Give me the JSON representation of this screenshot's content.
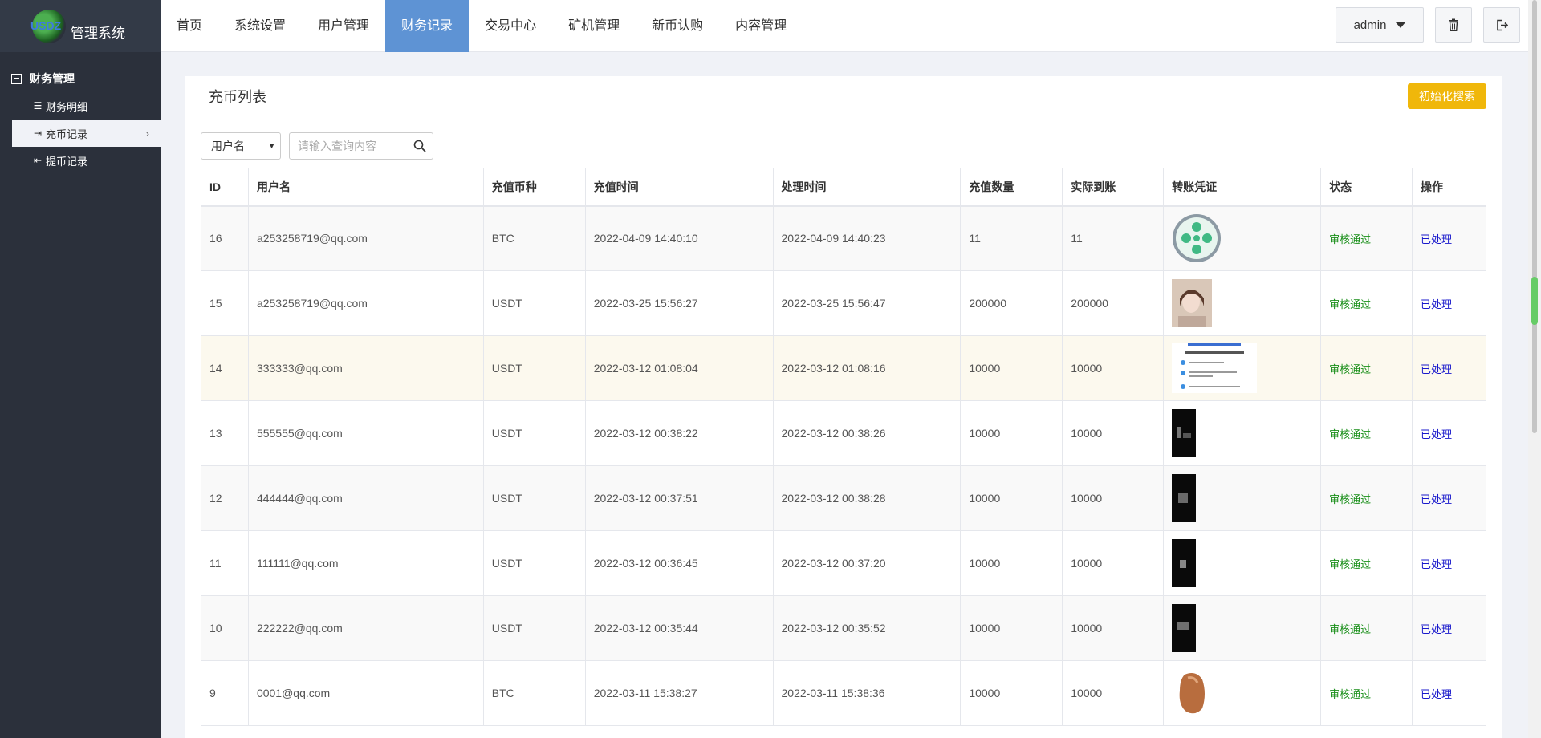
{
  "logo": {
    "mark_text": "USDZ",
    "name": "管理系统"
  },
  "sidebar": {
    "group": "财务管理",
    "items": [
      {
        "label": "财务明细",
        "icon": "list-icon"
      },
      {
        "label": "充币记录",
        "icon": "sign-in-icon",
        "active": true
      },
      {
        "label": "提币记录",
        "icon": "sign-out-icon"
      }
    ]
  },
  "nav": [
    "首页",
    "系统设置",
    "用户管理",
    "财务记录",
    "交易中心",
    "矿机管理",
    "新币认购",
    "内容管理"
  ],
  "nav_active": "财务记录",
  "toolbar": {
    "admin_label": "admin"
  },
  "page": {
    "title": "充币列表",
    "init_search_label": "初始化搜索"
  },
  "search": {
    "select_value": "用户名",
    "placeholder": "请输入查询内容"
  },
  "table": {
    "headers": [
      "ID",
      "用户名",
      "充值币种",
      "充值时间",
      "处理时间",
      "充值数量",
      "实际到账",
      "转账凭证",
      "状态",
      "操作"
    ],
    "rows": [
      {
        "id": "16",
        "user": "a253258719@qq.com",
        "coin": "BTC",
        "time": "2022-04-09 14:40:10",
        "processed": "2022-04-09 14:40:23",
        "amount": "11",
        "received": "11",
        "status": "审核通过",
        "op": "已处理"
      },
      {
        "id": "15",
        "user": "a253258719@qq.com",
        "coin": "USDT",
        "time": "2022-03-25 15:56:27",
        "processed": "2022-03-25 15:56:47",
        "amount": "200000",
        "received": "200000",
        "status": "审核通过",
        "op": "已处理"
      },
      {
        "id": "14",
        "user": "333333@qq.com",
        "coin": "USDT",
        "time": "2022-03-12 01:08:04",
        "processed": "2022-03-12 01:08:16",
        "amount": "10000",
        "received": "10000",
        "status": "审核通过",
        "op": "已处理"
      },
      {
        "id": "13",
        "user": "555555@qq.com",
        "coin": "USDT",
        "time": "2022-03-12 00:38:22",
        "processed": "2022-03-12 00:38:26",
        "amount": "10000",
        "received": "10000",
        "status": "审核通过",
        "op": "已处理"
      },
      {
        "id": "12",
        "user": "444444@qq.com",
        "coin": "USDT",
        "time": "2022-03-12 00:37:51",
        "processed": "2022-03-12 00:38:28",
        "amount": "10000",
        "received": "10000",
        "status": "审核通过",
        "op": "已处理"
      },
      {
        "id": "11",
        "user": "111111@qq.com",
        "coin": "USDT",
        "time": "2022-03-12 00:36:45",
        "processed": "2022-03-12 00:37:20",
        "amount": "10000",
        "received": "10000",
        "status": "审核通过",
        "op": "已处理"
      },
      {
        "id": "10",
        "user": "222222@qq.com",
        "coin": "USDT",
        "time": "2022-03-12 00:35:44",
        "processed": "2022-03-12 00:35:52",
        "amount": "10000",
        "received": "10000",
        "status": "审核通过",
        "op": "已处理"
      },
      {
        "id": "9",
        "user": "0001@qq.com",
        "coin": "BTC",
        "time": "2022-03-11 15:38:27",
        "processed": "2022-03-11 15:38:36",
        "amount": "10000",
        "received": "10000",
        "status": "审核通过",
        "op": "已处理"
      }
    ]
  },
  "colors": {
    "nav_active": "#5e93d4",
    "sidebar": "#2b303b",
    "accent_button": "#f0b70a",
    "status_ok": "#1a8f1a",
    "link": "#1a1acc"
  }
}
